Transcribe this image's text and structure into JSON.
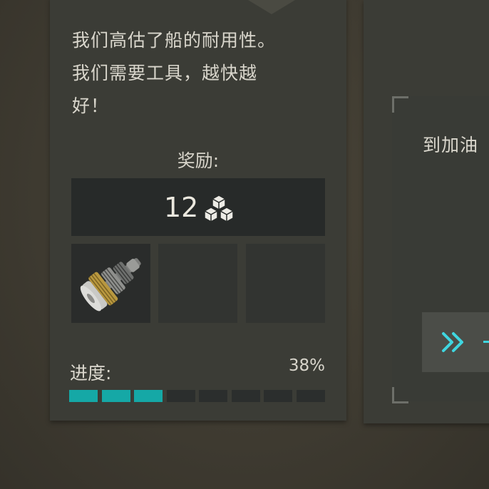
{
  "quest": {
    "description": "我们高估了船的耐用性。\n我们需要工具，越快越\n好！",
    "reward_label": "奖励:",
    "reward_amount": "12",
    "reward_icon": "supply-cubes-icon",
    "item_slots": [
      {
        "item": "gear-shaft-icon"
      },
      {
        "item": ""
      },
      {
        "item": ""
      }
    ],
    "progress_label": "进度:",
    "progress_text": "38%",
    "progress_fraction": 0.38,
    "progress_segments_total": 8,
    "progress_segments_filled": 3
  },
  "side_quest": {
    "title": "到加油",
    "action_icon": "double-chevron-right-icon"
  },
  "colors": {
    "accent": "#15a8a6",
    "action": "#3fd6e0",
    "card": "#3b3c36",
    "text": "#dad7cd"
  }
}
